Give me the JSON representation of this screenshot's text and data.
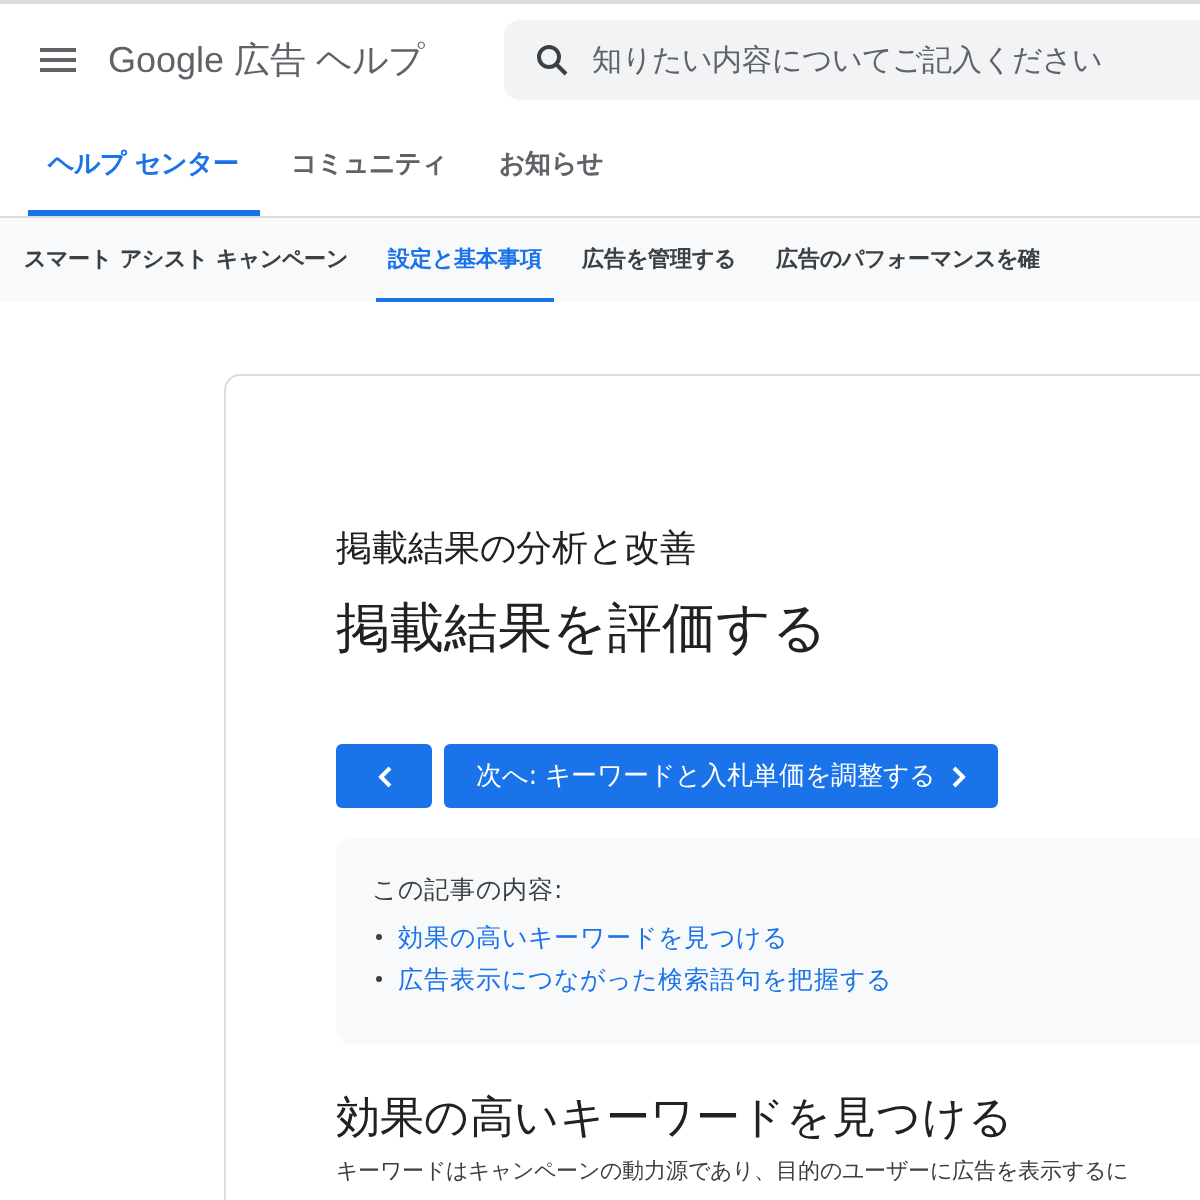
{
  "header": {
    "logo": "Google 広告 ヘルプ",
    "search": {
      "placeholder": "知りたい内容についてご記入ください"
    }
  },
  "tabs": [
    {
      "label": "ヘルプ センター",
      "selected": true
    },
    {
      "label": "コミュニティ",
      "selected": false
    },
    {
      "label": "お知らせ",
      "selected": false
    }
  ],
  "subnav": [
    {
      "label": "スマート アシスト キャンペーン",
      "selected": false
    },
    {
      "label": "設定と基本事項",
      "selected": true
    },
    {
      "label": "広告を管理する",
      "selected": false
    },
    {
      "label": "広告のパフォーマンスを確",
      "selected": false
    }
  ],
  "article": {
    "section": "掲載結果の分析と改善",
    "title": "掲載結果を評価する",
    "next_button": "次へ: キーワードと入札単価を調整する",
    "toc": {
      "heading": "この記事の内容:",
      "links": [
        "効果の高いキーワードを見つける",
        "広告表示につながった検索語句を把握する"
      ]
    },
    "heading": "効果の高いキーワードを見つける",
    "body": "キーワードはキャンペーンの動力源であり、目的のユーザーに広告を表示するに"
  }
}
